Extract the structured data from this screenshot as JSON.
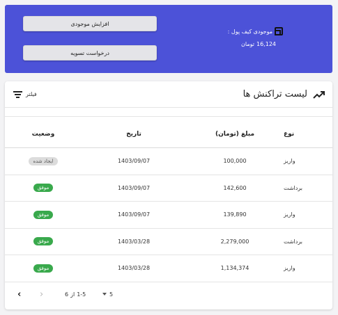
{
  "wallet": {
    "label": "موجودی کیف پول :",
    "balance": "16,124",
    "currency": "تومان",
    "increase_label": "افزایش موجودی",
    "settle_label": "درخواست تسویه"
  },
  "list": {
    "title": "لیست تراکنش ها",
    "filter_label": "فیلتر"
  },
  "table": {
    "headers": {
      "type": "نوع",
      "amount": "مبلغ (تومان)",
      "date": "تاریخ",
      "status": "وضعیت"
    },
    "rows": [
      {
        "type": "واریز",
        "amount": "100,000",
        "date": "1403/09/07",
        "status": "ایجاد شده"
      },
      {
        "type": "برداشت",
        "amount": "142,600",
        "date": "1403/09/07",
        "status": "موفق"
      },
      {
        "type": "واریز",
        "amount": "139,890",
        "date": "1403/09/07",
        "status": "موفق"
      },
      {
        "type": "برداشت",
        "amount": "2,279,000",
        "date": "1403/03/28",
        "status": "موفق"
      },
      {
        "type": "واریز",
        "amount": "1,134,374",
        "date": "1403/03/28",
        "status": "موفق"
      }
    ]
  },
  "pagination": {
    "page_size": "5",
    "range": "1-5",
    "of_label": "از",
    "total": "6",
    "next_arrow": "‹",
    "prev_arrow": "›"
  },
  "colors": {
    "wallet_bg": "#4c52d8",
    "success_badge": "#39a94c",
    "created_badge": "#dcdcdc"
  },
  "icons": {
    "wallet": "wallet-icon",
    "filter": "filter-icon",
    "trend": "trending-up-icon"
  }
}
